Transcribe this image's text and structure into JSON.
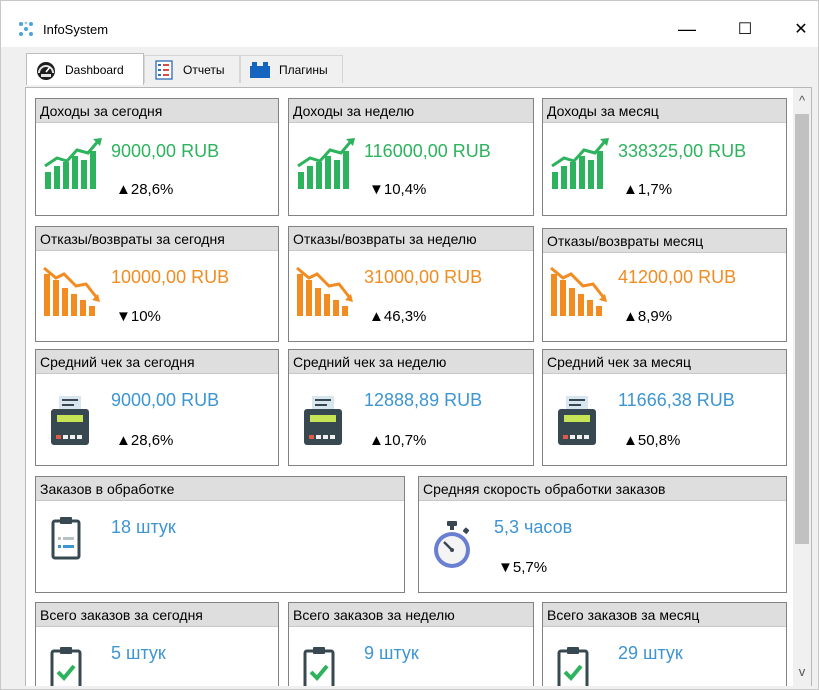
{
  "window": {
    "title": "InfoSystem",
    "minimize": "—",
    "maximize": "☐",
    "close": "✕"
  },
  "tabs": [
    {
      "label": "Dashboard",
      "active": true
    },
    {
      "label": "Отчеты",
      "active": false
    },
    {
      "label": "Плагины",
      "active": false
    }
  ],
  "cards": {
    "income_today": {
      "title": "Доходы за сегодня",
      "value": "9000,00 RUB",
      "delta": "▲28,6%"
    },
    "income_week": {
      "title": "Доходы за неделю",
      "value": "116000,00 RUB",
      "delta": "▼10,4%"
    },
    "income_month": {
      "title": "Доходы за месяц",
      "value": "338325,00 RUB",
      "delta": "▲1,7%"
    },
    "refunds_today": {
      "title": "Отказы/возвраты за сегодня",
      "value": "10000,00 RUB",
      "delta": "▼10%"
    },
    "refunds_week": {
      "title": "Отказы/возвраты за неделю",
      "value": "31000,00 RUB",
      "delta": "▲46,3%"
    },
    "refunds_month": {
      "title": "Отказы/возвраты месяц",
      "value": "41200,00 RUB",
      "delta": "▲8,9%"
    },
    "avg_today": {
      "title": "Средний чек за сегодня",
      "value": "9000,00 RUB",
      "delta": "▲28,6%"
    },
    "avg_week": {
      "title": "Средний чек за неделю",
      "value": "12888,89 RUB",
      "delta": "▲10,7%"
    },
    "avg_month": {
      "title": "Средний чек за месяц",
      "value": "11666,38 RUB",
      "delta": "▲50,8%"
    },
    "orders_processing": {
      "title": "Заказов в обработке",
      "value": "18 штук"
    },
    "avg_speed": {
      "title": "Средняя скорость обработки заказов",
      "value": "5,3 часов",
      "delta": "▼5,7%"
    },
    "total_today": {
      "title": "Всего заказов за сегодня",
      "value": "5 штук"
    },
    "total_week": {
      "title": "Всего заказов за неделю",
      "value": "9 штук"
    },
    "total_month": {
      "title": "Всего заказов за месяц",
      "value": "29 штук"
    }
  },
  "colors": {
    "income": "#2db35d",
    "refunds": "#f28c21",
    "info": "#3d95d2",
    "icon_dark": "#374850",
    "header_bg": "#dedede"
  },
  "scrollbar": {
    "up": "^",
    "down": "v"
  }
}
